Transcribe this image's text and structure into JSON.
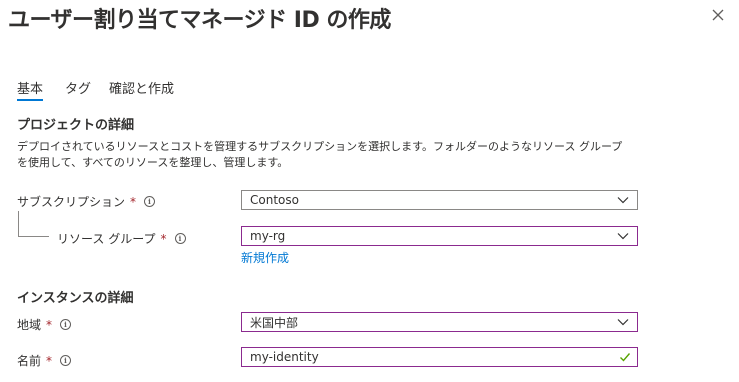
{
  "header": {
    "title": "ユーザー割り当てマネージド ID の作成",
    "more_label": "···",
    "close_icon": "close-icon"
  },
  "tabs": [
    {
      "label": "基本",
      "active": true
    },
    {
      "label": "タグ",
      "active": false
    },
    {
      "label": "確認と作成",
      "active": false
    }
  ],
  "project": {
    "title": "プロジェクトの詳細",
    "description": "デプロイされているリソースとコストを管理するサブスクリプションを選択します。フォルダーのようなリソース グループを使用して、すべてのリソースを整理し、管理します。"
  },
  "subscription": {
    "label": "サブスクリプション",
    "required": "*",
    "value": "Contoso"
  },
  "resource_group": {
    "label": "リソース グループ",
    "required": "*",
    "value": "my-rg",
    "create_new": "新規作成"
  },
  "instance": {
    "title": "インスタンスの詳細"
  },
  "region": {
    "label": "地域",
    "required": "*",
    "value": "米国中部"
  },
  "name": {
    "label": "名前",
    "required": "*",
    "value": "my-identity"
  },
  "colors": {
    "accent": "#0078d4",
    "focus_border": "#8b2a8f",
    "required": "#a4262c",
    "valid": "#57a300"
  }
}
